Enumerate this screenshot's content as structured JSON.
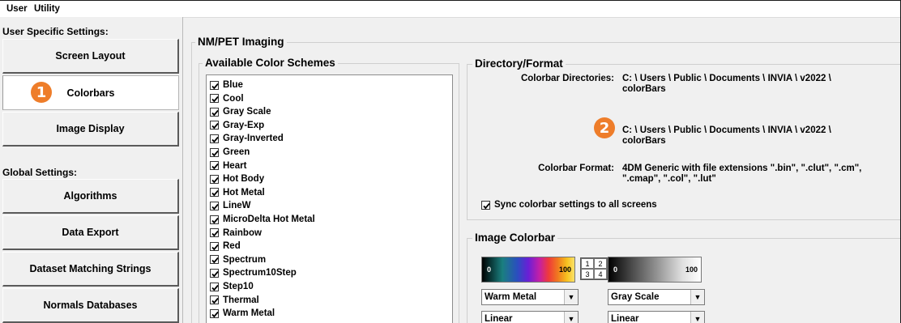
{
  "menu": [
    "User",
    "Utility"
  ],
  "user_settings_label": "User Specific Settings:",
  "global_settings_label": "Global Settings:",
  "nav": {
    "screen_layout": "Screen Layout",
    "colorbars": "Colorbars",
    "image_display": "Image Display",
    "algorithms": "Algorithms",
    "data_export": "Data Export",
    "dataset_matching": "Dataset Matching Strings",
    "normals_databases": "Normals Databases"
  },
  "badges": {
    "one": "1",
    "two": "2"
  },
  "nmpet_title": "NM/PET Imaging",
  "available_schemes_title": "Available Color Schemes",
  "schemes": [
    "Blue",
    "Cool",
    "Gray Scale",
    "Gray-Exp",
    "Gray-Inverted",
    "Green",
    "Heart",
    "Hot Body",
    "Hot Metal",
    "LineW",
    "MicroDelta Hot Metal",
    "Rainbow",
    "Red",
    "Spectrum",
    "Spectrum10Step",
    "Step10",
    "Thermal",
    "Warm Metal"
  ],
  "directory": {
    "title": "Directory/Format",
    "dirs_label": "Colorbar Directories:",
    "dir1_line1": "C: \\ Users \\ Public \\ Documents \\ INVIA \\ v2022 \\",
    "dir1_line2": "colorBars",
    "dir2_line1": "C: \\ Users \\ Public \\ Documents \\ INVIA \\ v2022 \\",
    "dir2_line2": "colorBars",
    "format_label": "Colorbar Format:",
    "format_line1": "4DM Generic with file extensions \".bin\", \".clut\", \".cm\",",
    "format_line2": "\".cmap\", \".col\", \".lut\"",
    "sync_label": "Sync colorbar settings to all screens",
    "sync_checked": true
  },
  "image_colorbar": {
    "title": "Image Colorbar",
    "left": {
      "min": "0",
      "max": "100",
      "scheme": "Warm Metal",
      "scale": "Linear"
    },
    "right": {
      "min": "0",
      "max": "100",
      "scheme": "Gray Scale",
      "scale": "Linear"
    },
    "grid": [
      "1",
      "2",
      "3",
      "4"
    ]
  },
  "colors": {
    "badge": "#ee7d2a",
    "background": "#f0f0f0"
  }
}
